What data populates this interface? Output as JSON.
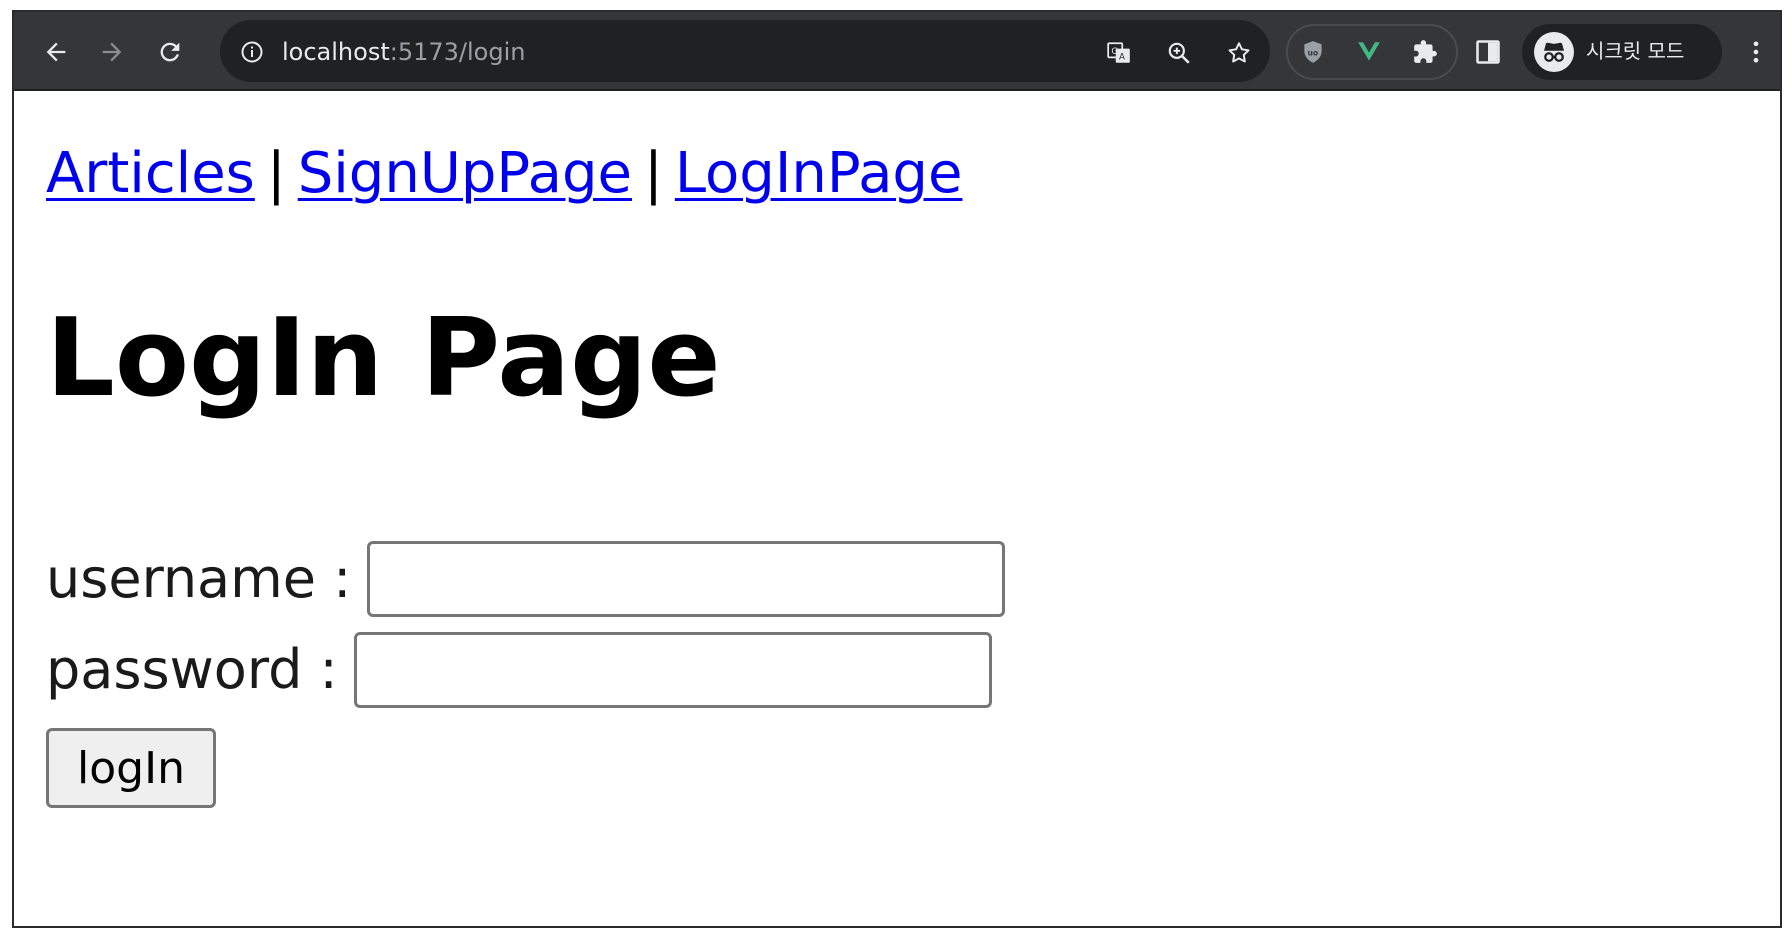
{
  "browser": {
    "url_host": "localhost",
    "url_rest": ":5173/login",
    "profile_label": "시크릿 모드",
    "icons": [
      "back-arrow-icon",
      "forward-arrow-icon",
      "reload-icon",
      "info-icon",
      "translate-icon",
      "zoom-icon",
      "bookmark-star-icon",
      "shield-extension-icon",
      "vue-devtools-icon",
      "puzzle-extensions-icon",
      "side-panel-icon",
      "incognito-icon",
      "kebab-menu-icon"
    ]
  },
  "nav": {
    "links": [
      {
        "label": "Articles"
      },
      {
        "label": "SignUpPage"
      },
      {
        "label": "LogInPage"
      }
    ],
    "separator": "|"
  },
  "main": {
    "title": "LogIn Page",
    "username_label": "username :",
    "username_value": "",
    "password_label": "password :",
    "password_value": "",
    "submit_label": "logIn"
  },
  "colors": {
    "toolbar": "#35363a",
    "omnibox": "#202124",
    "link": "#0000ee",
    "vue_green": "#42b883"
  }
}
